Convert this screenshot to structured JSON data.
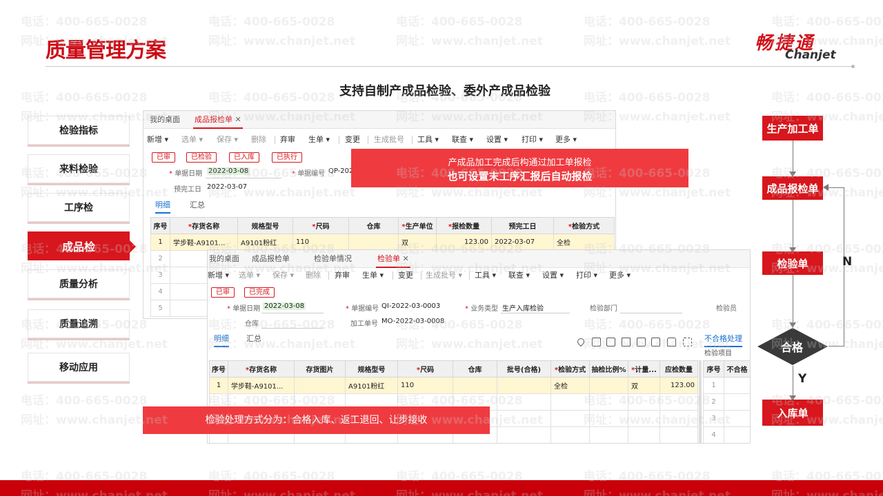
{
  "header": {
    "title": "质量管理方案",
    "logo_cn": "畅捷通",
    "logo_en": "Chanjet"
  },
  "subtitle": "支持自制产成品检验、委外产成品检验",
  "watermark": {
    "phone": "电话：400-665-0028",
    "site": "网址：www.chanjet.net"
  },
  "nav": {
    "items": [
      {
        "label": "检验指标"
      },
      {
        "label": "来料检验"
      },
      {
        "label": "工序检"
      },
      {
        "label": "成品检"
      },
      {
        "label": "质量分析"
      },
      {
        "label": "质量追溯"
      },
      {
        "label": "移动应用"
      }
    ],
    "active_index": 3
  },
  "win1": {
    "tabs": [
      "我的桌面",
      "成品报检单"
    ],
    "toolbar": [
      "新增",
      "选单",
      "保存",
      "删除",
      "弃审",
      "生单",
      "变更",
      "生成批号",
      "工具",
      "联查",
      "设置",
      "打印",
      "更多"
    ],
    "badges": [
      "已审",
      "已检验",
      "已入库",
      "已执行"
    ],
    "fields": {
      "doc_date_label": "单据日期",
      "doc_date": "2022-03-08",
      "doc_no_label": "单据编号",
      "doc_no": "QP-202",
      "plan_date_label": "预完工日",
      "plan_date": "2022-03-07"
    },
    "subtabs": [
      "明细",
      "汇总"
    ],
    "columns": [
      "序号",
      "存货名称",
      "规格型号",
      "尺码",
      "仓库",
      "生产单位",
      "报检数量",
      "预完工日",
      "检验方式"
    ],
    "row": [
      "1",
      "学步鞋-A9101...",
      "A9101粉红",
      "110",
      "",
      "双",
      "123.00",
      "2022-03-07",
      "全检"
    ],
    "empty_rows": [
      "2",
      "3",
      "4",
      "5"
    ]
  },
  "win2": {
    "tabs": [
      "我的桌面",
      "成品报检单",
      "检验单情况",
      "检验单"
    ],
    "toolbar": [
      "新增",
      "选单",
      "保存",
      "删除",
      "弃审",
      "生单",
      "变更",
      "生成批号",
      "工具",
      "联查",
      "设置",
      "打印",
      "更多"
    ],
    "badges": [
      "已审",
      "已完成"
    ],
    "fields": {
      "doc_date_label": "单据日期",
      "doc_date": "2022-03-08",
      "doc_no_label": "单据编号",
      "doc_no": "QI-2022-03-0003",
      "biz_type_label": "业务类型",
      "biz_type": "生产入库检验",
      "dept_label": "检验部门",
      "inspector_label": "检验员",
      "warehouse_label": "仓库",
      "work_order_label": "加工单号",
      "work_order": "MO-2022-03-0008"
    },
    "subtabs": [
      "明细",
      "汇总"
    ],
    "side_tabs": [
      "不合格处理",
      "检验项目"
    ],
    "columns": [
      "序号",
      "存货名称",
      "存货图片",
      "规格型号",
      "尺码",
      "仓库",
      "批号(合格)",
      "检验方式",
      "抽检比例%",
      "计量...",
      "应检数量"
    ],
    "row": [
      "1",
      "学步鞋-A9101...",
      "",
      "A9101粉红",
      "110",
      "",
      "",
      "全检",
      "",
      "双",
      "123.00"
    ],
    "side_columns": [
      "序号",
      "不合格"
    ],
    "side_rows": [
      "1",
      "2",
      "3",
      "4"
    ]
  },
  "callouts": {
    "top_line1": "产成品加工完成后构通过加工单报检",
    "top_line2": "也可设置末工序汇报后自动报检",
    "bottom": "检验处理方式分为：合格入库、返工退回、让步接收"
  },
  "flow": {
    "steps": [
      "生产加工单",
      "成品报检单",
      "检验单",
      "合格",
      "入库单"
    ],
    "no_label": "N",
    "yes_label": "Y"
  },
  "colors": {
    "brand_red": "#d7161d",
    "callout_red": "#ef3b40",
    "bottom_bar": "#c9000a"
  }
}
